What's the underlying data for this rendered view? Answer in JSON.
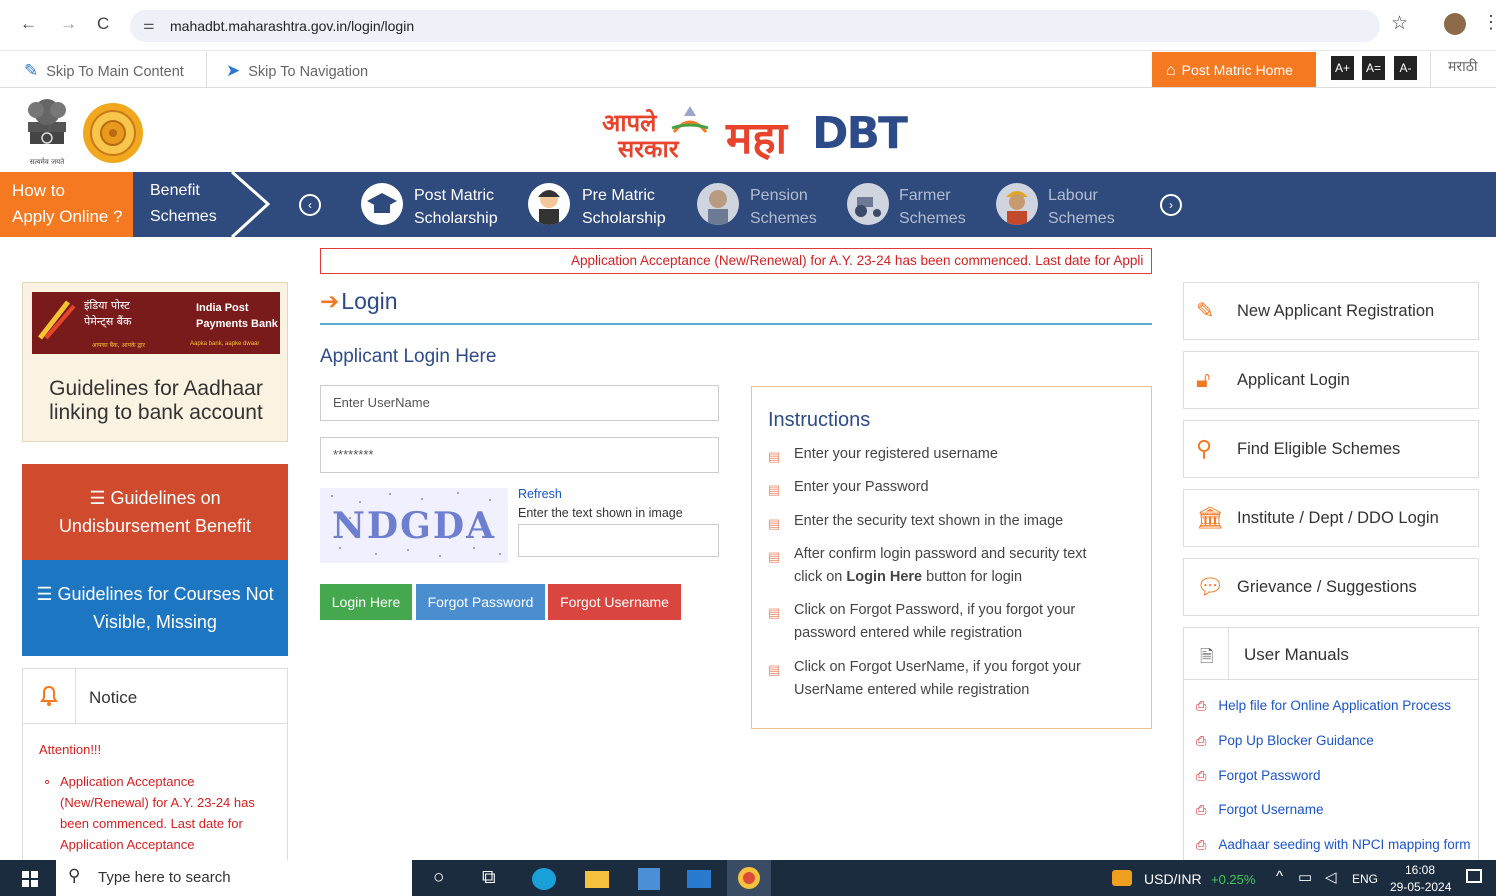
{
  "browser": {
    "url": "mahadbt.maharashtra.gov.in/login/login"
  },
  "skipbar": {
    "skip_main": "Skip To Main Content",
    "skip_nav": "Skip To Navigation",
    "post_matric_home": "Post Matric Home",
    "font_increase": "A+",
    "font_reset": "A=",
    "font_decrease": "A-",
    "language": "मराठी"
  },
  "header": {
    "logo_aaple": "आपले",
    "logo_sarkar": "सरकार",
    "logo_maha": "महा",
    "logo_dbt": "DBT",
    "emblem_motto": "सत्यमेव जयते"
  },
  "nav": {
    "how_to": [
      "How to",
      "Apply Online ?"
    ],
    "benefit": [
      "Benefit",
      "Schemes"
    ],
    "items": [
      {
        "l1": "Post Matric",
        "l2": "Scholarship"
      },
      {
        "l1": "Pre Matric",
        "l2": "Scholarship"
      },
      {
        "l1": "Pension",
        "l2": "Schemes"
      },
      {
        "l1": "Farmer",
        "l2": "Schemes"
      },
      {
        "l1": "Labour",
        "l2": "Schemes"
      }
    ]
  },
  "left": {
    "ippb_hindi_1": "इंडिया पोस्ट",
    "ippb_hindi_2": "पेमेन्ट्स बैंक",
    "ippb_en_1": "India Post",
    "ippb_en_2": "Payments Bank",
    "ippb_tag_hi": "आपका बैंक, आपके द्वार",
    "ippb_tag_en": "Aapka bank, aapke dwaar",
    "aadhaar_title": "Guidelines for Aadhaar linking to bank account",
    "undisbursement": "Guidelines on Undisbursement Benefit",
    "courses": "Guidelines for Courses Not Visible, Missing",
    "notice_title": "Notice",
    "attention": "Attention!!!",
    "notice_item": "Application Acceptance (New/Renewal) for A.Y. 23-24 has been commenced. Last date for Application Acceptance"
  },
  "ticker": "Application Acceptance (New/Renewal) for A.Y. 23-24 has been commenced. Last date for Appli",
  "login": {
    "title": "Login",
    "subtitle": "Applicant Login Here",
    "username_placeholder": "Enter UserName",
    "password_value": "********",
    "captcha_text": "NDGDA",
    "refresh": "Refresh",
    "captcha_hint": "Enter the text shown in image",
    "btn_login": "Login Here",
    "btn_forgot_pw": "Forgot Password",
    "btn_forgot_user": "Forgot Username"
  },
  "instructions": {
    "title": "Instructions",
    "items": [
      "Enter your registered username",
      "Enter your Password",
      "Enter the security text shown in the image",
      "After confirm login password and security text",
      "click on",
      "Login Here",
      "button for login",
      "Click on Forgot Password, if you forgot your password entered while registration",
      "Click on Forgot UserName, if you forgot your UserName entered while registration"
    ]
  },
  "right": {
    "boxes": [
      "New Applicant Registration",
      "Applicant Login",
      "Find Eligible Schemes",
      "Institute / Dept / DDO Login",
      "Grievance / Suggestions"
    ],
    "manuals_title": "User Manuals",
    "manuals": [
      "Help file for Online Application Process",
      "Pop Up Blocker Guidance",
      "Forgot Password",
      "Forgot Username",
      "Aadhaar seeding with NPCI mapping form"
    ]
  },
  "taskbar": {
    "search": "Type here to search",
    "currency": "USD/INR",
    "change": "+0.25%",
    "lang": "ENG",
    "time": "16:08",
    "date": "29-05-2024"
  }
}
